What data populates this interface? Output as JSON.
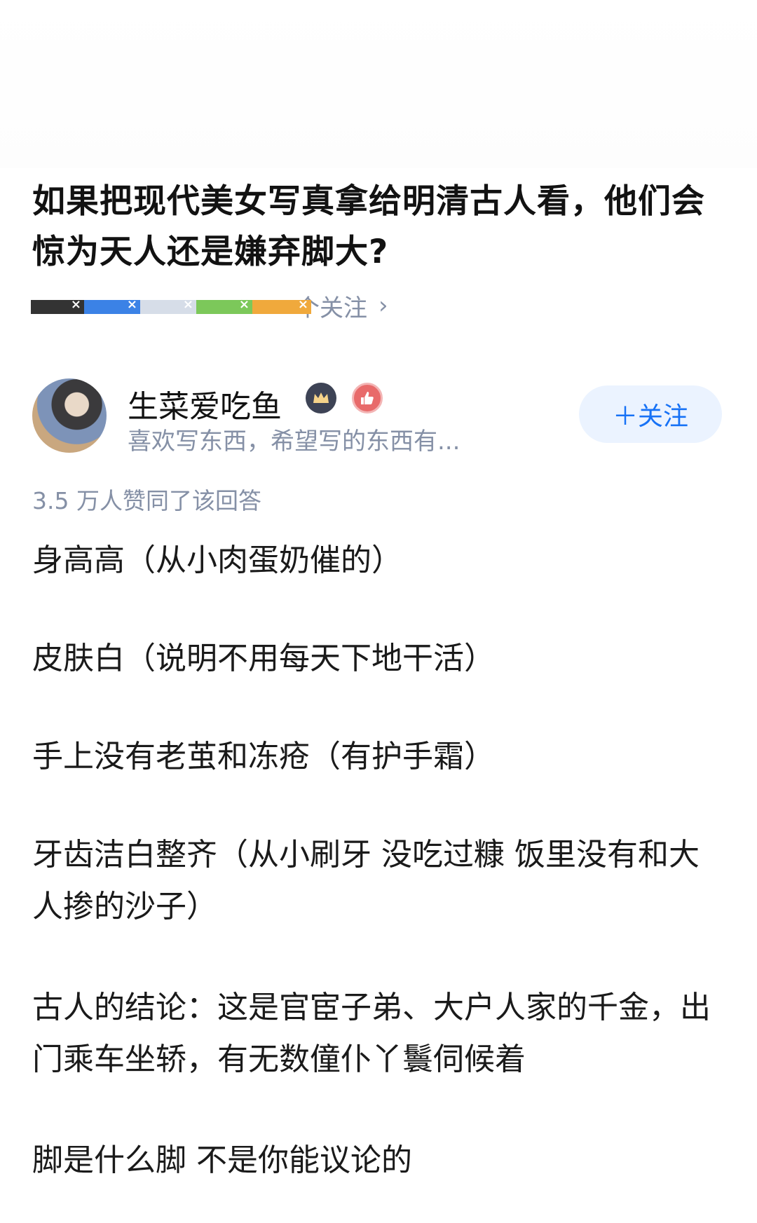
{
  "question": {
    "title": "如果把现代美女写真拿给明清古人看，他们会惊为天人还是嫌弃脚大?",
    "meta": {
      "followers_suffix": "个关注",
      "chevron": "›"
    }
  },
  "redaction": {
    "colors": [
      "#333333",
      "#3b82e6",
      "#d6dde8",
      "#7cc85a",
      "#f0a93c"
    ]
  },
  "author": {
    "name": "生菜爱吃鱼",
    "bio": "喜欢写东西，希望写的东西有...",
    "badge_icons": [
      "crown-badge-icon",
      "thumbs-up-badge-icon"
    ],
    "follow_label": "＋关注"
  },
  "answer": {
    "votes": "3.5 万人赞同了该回答",
    "paragraphs": [
      "身高高（从小肉蛋奶催的）",
      "皮肤白（说明不用每天下地干活）",
      "手上没有老茧和冻疮（有护手霜）",
      "牙齿洁白整齐（从小刷牙 没吃过糠 饭里没有和大人掺的沙子）",
      "古人的结论：这是官宦子弟、大户人家的千金，出门乘车坐轿，有无数僮仆丫鬟伺候着",
      "脚是什么脚 不是你能议论的"
    ]
  },
  "colors": {
    "accent": "#1772f6",
    "follow_bg": "#ebf3ff",
    "meta_text": "#8590a6",
    "body_text": "#1a1a1a"
  }
}
